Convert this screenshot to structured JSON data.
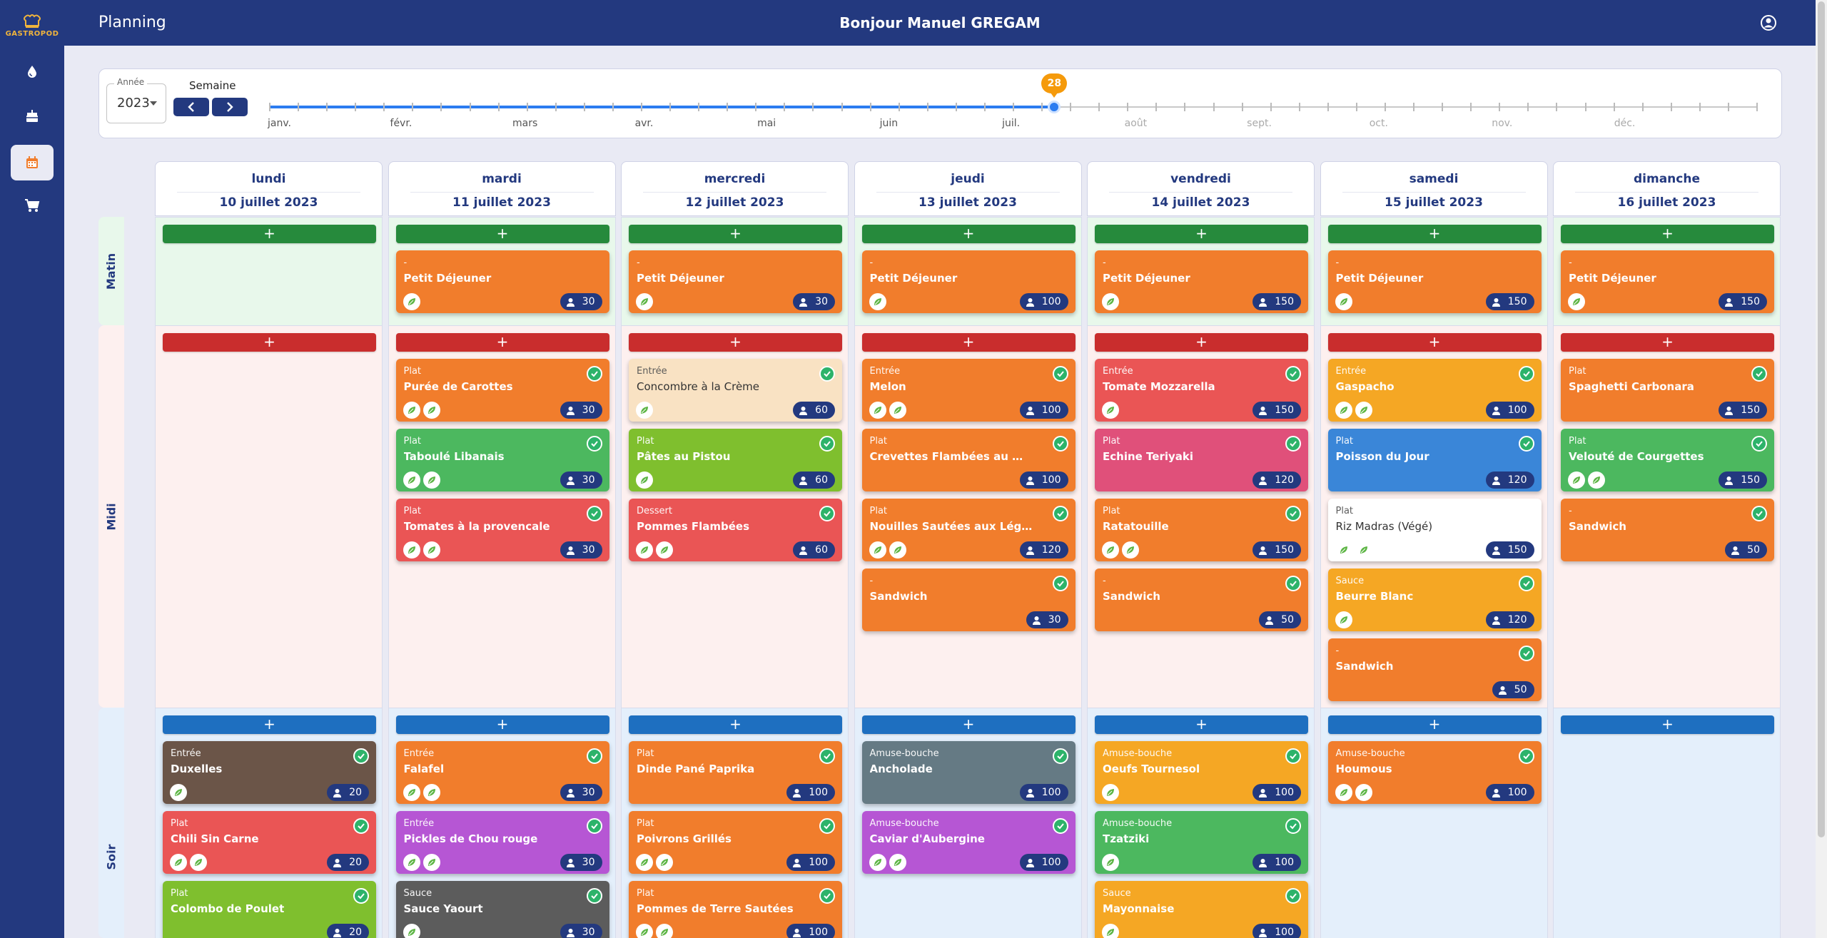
{
  "app": {
    "logo_text": "GASTROPOD",
    "page_title": "Planning",
    "greeting": "Bonjour Manuel GREGAM"
  },
  "sidebar": {
    "items": [
      {
        "icon": "water-drop-icon",
        "active": false
      },
      {
        "icon": "cake-icon",
        "active": false
      },
      {
        "icon": "calendar-icon",
        "active": true
      },
      {
        "icon": "cart-icon",
        "active": false
      }
    ]
  },
  "selector": {
    "year_label": "Année",
    "year": "2023",
    "week_label": "Semaine",
    "week": "28",
    "months": [
      "janv.",
      "févr.",
      "mars",
      "avr.",
      "mai",
      "juin",
      "juil.",
      "août",
      "sept.",
      "oct.",
      "nov.",
      "déc."
    ],
    "week_progress": 0.528
  },
  "sections": {
    "morning": "Matin",
    "noon": "Midi",
    "evening": "Soir"
  },
  "colors": {
    "orange": "#f17d2c",
    "green": "#4cb85f",
    "red": "#ea5555",
    "lime": "#7fbf2e",
    "peach": "#f9e2c3",
    "pink": "#e0507a",
    "amber": "#f5a724",
    "blue": "#3a86d8",
    "white": "#ffffff",
    "brown": "#6b5548",
    "purple": "#b656d4",
    "gray": "#5c5c5c",
    "slate": "#657a84",
    "navy": "#23397f"
  },
  "days": [
    {
      "name": "lundi",
      "date": "10 juillet 2023",
      "morning": [],
      "noon": [],
      "evening": [
        {
          "cat": "Entrée",
          "name": "Duxelles",
          "count": "20",
          "leaves": 1,
          "check": true,
          "color": "brown"
        },
        {
          "cat": "Plat",
          "name": "Chili Sin Carne",
          "count": "20",
          "leaves": 2,
          "check": true,
          "color": "red"
        },
        {
          "cat": "Plat",
          "name": "Colombo de Poulet",
          "count": "20",
          "leaves": 0,
          "check": true,
          "color": "lime"
        }
      ]
    },
    {
      "name": "mardi",
      "date": "11 juillet 2023",
      "morning": [
        {
          "cat": "-",
          "name": "Petit Déjeuner",
          "count": "30",
          "leaves": 1,
          "check": false,
          "color": "orange"
        }
      ],
      "noon": [
        {
          "cat": "Plat",
          "name": "Purée de Carottes",
          "count": "30",
          "leaves": 2,
          "check": true,
          "color": "orange"
        },
        {
          "cat": "Plat",
          "name": "Taboulé Libanais",
          "count": "30",
          "leaves": 2,
          "check": true,
          "color": "green"
        },
        {
          "cat": "Plat",
          "name": "Tomates à la provencale",
          "count": "30",
          "leaves": 2,
          "check": true,
          "color": "red"
        }
      ],
      "evening": [
        {
          "cat": "Entrée",
          "name": "Falafel",
          "count": "30",
          "leaves": 2,
          "check": true,
          "color": "orange"
        },
        {
          "cat": "Entrée",
          "name": "Pickles de Chou rouge",
          "count": "30",
          "leaves": 2,
          "check": true,
          "color": "purple"
        },
        {
          "cat": "Sauce",
          "name": "Sauce Yaourt",
          "count": "30",
          "leaves": 1,
          "check": true,
          "color": "gray"
        }
      ]
    },
    {
      "name": "mercredi",
      "date": "12 juillet 2023",
      "morning": [
        {
          "cat": "-",
          "name": "Petit Déjeuner",
          "count": "30",
          "leaves": 1,
          "check": false,
          "color": "orange"
        }
      ],
      "noon": [
        {
          "cat": "Entrée",
          "name": "Concombre à la Crème",
          "count": "60",
          "leaves": 1,
          "check": true,
          "color": "peach"
        },
        {
          "cat": "Plat",
          "name": "Pâtes au Pistou",
          "count": "60",
          "leaves": 1,
          "check": true,
          "color": "lime"
        },
        {
          "cat": "Dessert",
          "name": "Pommes Flambées",
          "count": "60",
          "leaves": 2,
          "check": true,
          "color": "red"
        }
      ],
      "evening": [
        {
          "cat": "Plat",
          "name": "Dinde Pané Paprika",
          "count": "100",
          "leaves": 0,
          "check": true,
          "color": "orange"
        },
        {
          "cat": "Plat",
          "name": "Poivrons Grillés",
          "count": "100",
          "leaves": 2,
          "check": true,
          "color": "orange"
        },
        {
          "cat": "Plat",
          "name": "Pommes de Terre Sautées",
          "count": "100",
          "leaves": 2,
          "check": true,
          "color": "orange"
        }
      ]
    },
    {
      "name": "jeudi",
      "date": "13 juillet 2023",
      "morning": [
        {
          "cat": "-",
          "name": "Petit Déjeuner",
          "count": "100",
          "leaves": 1,
          "check": false,
          "color": "orange"
        }
      ],
      "noon": [
        {
          "cat": "Entrée",
          "name": "Melon",
          "count": "100",
          "leaves": 2,
          "check": true,
          "color": "orange"
        },
        {
          "cat": "Plat",
          "name": "Crevettes Flambées au Whisky",
          "count": "100",
          "leaves": 0,
          "check": true,
          "color": "orange"
        },
        {
          "cat": "Plat",
          "name": "Nouilles Sautées aux Légumes",
          "count": "120",
          "leaves": 2,
          "check": true,
          "color": "orange"
        },
        {
          "cat": "-",
          "name": "Sandwich",
          "count": "30",
          "leaves": 0,
          "check": true,
          "color": "orange"
        }
      ],
      "evening": [
        {
          "cat": "Amuse-bouche",
          "name": "Ancholade",
          "count": "100",
          "leaves": 0,
          "check": true,
          "color": "slate"
        },
        {
          "cat": "Amuse-bouche",
          "name": "Caviar d'Aubergine",
          "count": "100",
          "leaves": 2,
          "check": true,
          "color": "purple"
        }
      ]
    },
    {
      "name": "vendredi",
      "date": "14 juillet 2023",
      "morning": [
        {
          "cat": "-",
          "name": "Petit Déjeuner",
          "count": "150",
          "leaves": 1,
          "check": false,
          "color": "orange"
        }
      ],
      "noon": [
        {
          "cat": "Entrée",
          "name": "Tomate Mozzarella",
          "count": "150",
          "leaves": 1,
          "check": true,
          "color": "red"
        },
        {
          "cat": "Plat",
          "name": "Echine Teriyaki",
          "count": "120",
          "leaves": 0,
          "check": true,
          "color": "pink"
        },
        {
          "cat": "Plat",
          "name": "Ratatouille",
          "count": "150",
          "leaves": 2,
          "check": true,
          "color": "orange"
        },
        {
          "cat": "-",
          "name": "Sandwich",
          "count": "50",
          "leaves": 0,
          "check": true,
          "color": "orange"
        }
      ],
      "evening": [
        {
          "cat": "Amuse-bouche",
          "name": "Oeufs Tournesol",
          "count": "100",
          "leaves": 1,
          "check": true,
          "color": "amber"
        },
        {
          "cat": "Amuse-bouche",
          "name": "Tzatziki",
          "count": "100",
          "leaves": 1,
          "check": true,
          "color": "green"
        },
        {
          "cat": "Sauce",
          "name": "Mayonnaise",
          "count": "100",
          "leaves": 1,
          "check": true,
          "color": "amber"
        }
      ]
    },
    {
      "name": "samedi",
      "date": "15 juillet 2023",
      "morning": [
        {
          "cat": "-",
          "name": "Petit Déjeuner",
          "count": "150",
          "leaves": 1,
          "check": false,
          "color": "orange"
        }
      ],
      "noon": [
        {
          "cat": "Entrée",
          "name": "Gaspacho",
          "count": "100",
          "leaves": 2,
          "check": true,
          "color": "amber"
        },
        {
          "cat": "Plat",
          "name": "Poisson du Jour",
          "count": "120",
          "leaves": 0,
          "check": true,
          "color": "blue"
        },
        {
          "cat": "Plat",
          "name": "Riz Madras (Végé)",
          "count": "150",
          "leaves": 2,
          "check": false,
          "color": "white"
        },
        {
          "cat": "Sauce",
          "name": "Beurre Blanc",
          "count": "120",
          "leaves": 1,
          "check": true,
          "color": "amber"
        },
        {
          "cat": "-",
          "name": "Sandwich",
          "count": "50",
          "leaves": 0,
          "check": true,
          "color": "orange"
        }
      ],
      "evening": [
        {
          "cat": "Amuse-bouche",
          "name": "Houmous",
          "count": "100",
          "leaves": 2,
          "check": true,
          "color": "orange"
        }
      ]
    },
    {
      "name": "dimanche",
      "date": "16 juillet 2023",
      "morning": [
        {
          "cat": "-",
          "name": "Petit Déjeuner",
          "count": "150",
          "leaves": 1,
          "check": false,
          "color": "orange"
        }
      ],
      "noon": [
        {
          "cat": "Plat",
          "name": "Spaghetti Carbonara",
          "count": "150",
          "leaves": 0,
          "check": true,
          "color": "orange"
        },
        {
          "cat": "Plat",
          "name": "Velouté de Courgettes",
          "count": "150",
          "leaves": 2,
          "check": true,
          "color": "green"
        },
        {
          "cat": "-",
          "name": "Sandwich",
          "count": "50",
          "leaves": 0,
          "check": true,
          "color": "orange"
        }
      ],
      "evening": []
    }
  ]
}
